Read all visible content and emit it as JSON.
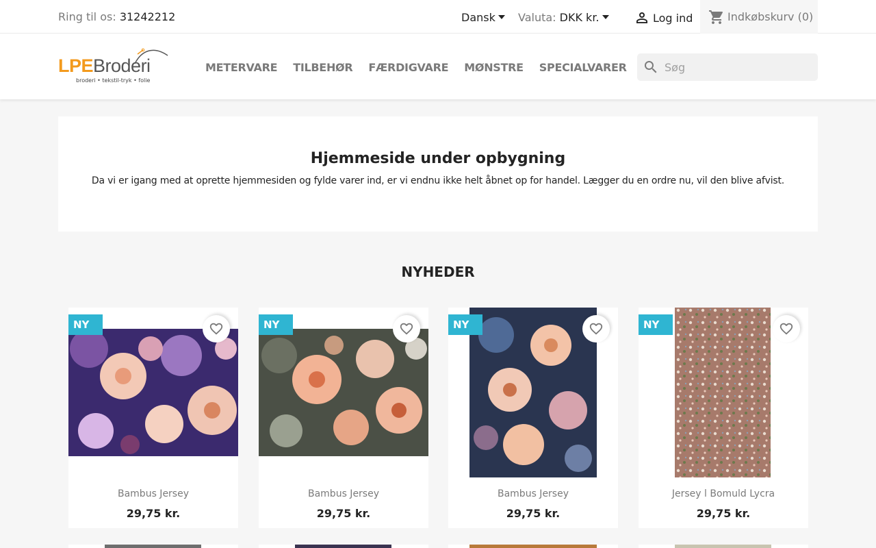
{
  "topbar": {
    "phone_label": "Ring til os:",
    "phone_number": "31242212",
    "language": "Dansk",
    "currency_label": "Valuta:",
    "currency_value": "DKK kr.",
    "login_label": "Log ind",
    "cart_label": "Indkøbskurv",
    "cart_count": "(0)"
  },
  "header": {
    "logo_text_a": "LPE",
    "logo_text_b": "Broderi",
    "logo_tagline": "broderi • tekstil-tryk • folie",
    "nav": [
      "METERVARE",
      "TILBEHØR",
      "FÆRDIGVARE",
      "MØNSTRE",
      "SPECIALVARER"
    ],
    "search_placeholder": "Søg"
  },
  "notice": {
    "title": "Hjemmeside under opbygning",
    "text": "Da vi er igang med at oprette hjemmesiden og fylde varer ind, er vi endnu ikke helt åbnet op for handel. Lægger du en ordre nu, vil den blive afvist."
  },
  "new_products": {
    "title": "NYHEDER",
    "items": [
      {
        "flag": "NY",
        "name": "Bambus Jersey",
        "price": "29,75 kr."
      },
      {
        "flag": "NY",
        "name": "Bambus Jersey",
        "price": "29,75 kr."
      },
      {
        "flag": "NY",
        "name": "Bambus Jersey",
        "price": "29,75 kr."
      },
      {
        "flag": "NY",
        "name": "Jersey l Bomuld Lycra",
        "price": "29,75 kr."
      }
    ]
  },
  "colors": {
    "accent": "#2fb5d2",
    "logo_orange": "#f39a1d"
  }
}
